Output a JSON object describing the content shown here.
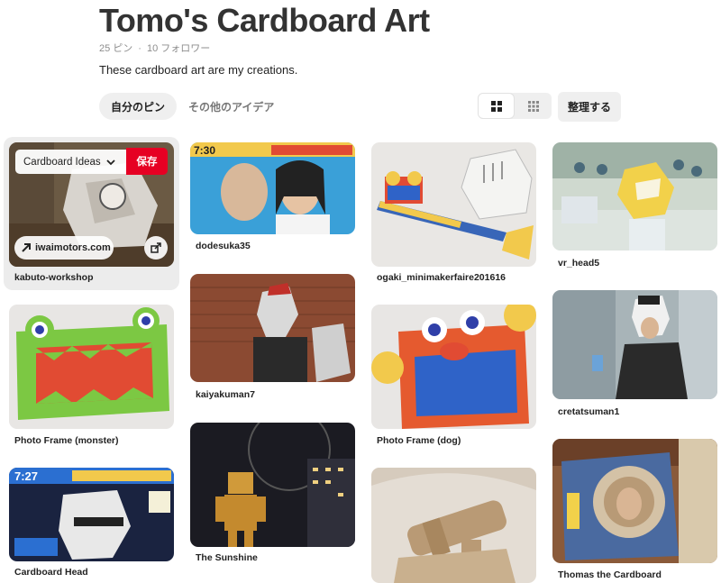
{
  "board": {
    "title": "Tomo's Cardboard Art",
    "pins_count": "25 ピン",
    "followers_count": "10 フォロワー",
    "description": "These cardboard art are my creations."
  },
  "tabs": [
    {
      "label": "自分のピン",
      "active": true
    },
    {
      "label": "その他のアイデア",
      "active": false
    }
  ],
  "toolbar": {
    "organize_label": "整理する",
    "view_modes": [
      "grid-large-icon",
      "grid-small-icon"
    ]
  },
  "hover_pin": {
    "board_select_value": "Cardboard Ideas",
    "save_label": "保存",
    "link_domain": "iwaimotors.com"
  },
  "pins": [
    {
      "caption": "kabuto-workshop",
      "image_text": "",
      "colors": {
        "bg": "#6b5a44",
        "accent": "#d8d4ce"
      }
    },
    {
      "caption": "Photo Frame (monster)",
      "image_text": "",
      "colors": {
        "bg": "#e8e6e4",
        "frame": "#7cc843",
        "inner": "#e14b33"
      }
    },
    {
      "caption": "Cardboard Head",
      "image_text": "7:27",
      "colors": {
        "bg": "#1a2340",
        "accent": "#e8e8e8"
      }
    },
    {
      "caption": "dodesuka35",
      "image_text": "7:30",
      "colors": {
        "bg": "#3aa0d8",
        "accent": "#f2c94c"
      }
    },
    {
      "caption": "kaiyakuman7",
      "image_text": "",
      "colors": {
        "bg": "#8b4a32",
        "accent": "#3a3a3a"
      }
    },
    {
      "caption": "The Sunshine",
      "image_text": "",
      "colors": {
        "bg": "#1b1b22",
        "accent": "#d09a3a"
      }
    },
    {
      "caption": "ogaki_minimakerfaire201616",
      "image_text": "",
      "colors": {
        "bg": "#e9e7e4",
        "accent": "#3866b8"
      }
    },
    {
      "caption": "Photo Frame (dog)",
      "image_text": "",
      "colors": {
        "bg": "#e8e6e4",
        "frame": "#e55a2f",
        "inner": "#2f63c8"
      }
    },
    {
      "caption": "",
      "image_text": "",
      "colors": {
        "bg": "#e4ddd4",
        "accent": "#b99a75"
      }
    },
    {
      "caption": "vr_head5",
      "image_text": "",
      "colors": {
        "bg": "#cfd9cf",
        "accent": "#f2d14a"
      }
    },
    {
      "caption": "cretatsuman1",
      "image_text": "",
      "colors": {
        "bg": "#a8b4b8",
        "accent": "#2a2a2a"
      }
    },
    {
      "caption": "Thomas the Cardboard",
      "image_text": "",
      "colors": {
        "bg": "#8a5a3a",
        "accent": "#4a6aa0"
      }
    }
  ]
}
